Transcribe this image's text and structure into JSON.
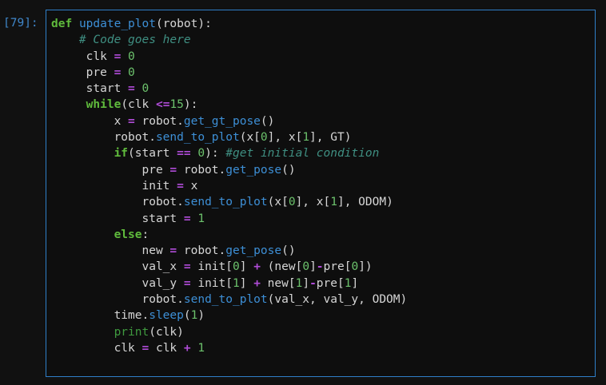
{
  "cell": {
    "prompt": "[79]:",
    "lines": [
      [
        [
          "kw",
          "def"
        ],
        [
          "tx",
          " "
        ],
        [
          "fn",
          "update_plot"
        ],
        [
          "tx",
          "(robot):"
        ]
      ],
      [
        [
          "tx",
          "    "
        ],
        [
          "cmt",
          "# Code goes here"
        ]
      ],
      [
        [
          "tx",
          "     clk "
        ],
        [
          "op",
          "="
        ],
        [
          "tx",
          " "
        ],
        [
          "num",
          "0"
        ]
      ],
      [
        [
          "tx",
          "     pre "
        ],
        [
          "op",
          "="
        ],
        [
          "tx",
          " "
        ],
        [
          "num",
          "0"
        ]
      ],
      [
        [
          "tx",
          "     start "
        ],
        [
          "op",
          "="
        ],
        [
          "tx",
          " "
        ],
        [
          "num",
          "0"
        ]
      ],
      [
        [
          "tx",
          "     "
        ],
        [
          "kw",
          "while"
        ],
        [
          "tx",
          "(clk "
        ],
        [
          "op",
          "<="
        ],
        [
          "num",
          "15"
        ],
        [
          "tx",
          "):"
        ]
      ],
      [
        [
          "tx",
          "         x "
        ],
        [
          "op",
          "="
        ],
        [
          "tx",
          " robot."
        ],
        [
          "fn",
          "get_gt_pose"
        ],
        [
          "tx",
          "()"
        ]
      ],
      [
        [
          "tx",
          "         robot."
        ],
        [
          "fn",
          "send_to_plot"
        ],
        [
          "tx",
          "(x["
        ],
        [
          "num",
          "0"
        ],
        [
          "tx",
          "], x["
        ],
        [
          "num",
          "1"
        ],
        [
          "tx",
          "], GT)"
        ]
      ],
      [
        [
          "tx",
          "         "
        ],
        [
          "kw",
          "if"
        ],
        [
          "tx",
          "(start "
        ],
        [
          "op",
          "=="
        ],
        [
          "tx",
          " "
        ],
        [
          "num",
          "0"
        ],
        [
          "tx",
          "): "
        ],
        [
          "cmt",
          "#get initial condition"
        ]
      ],
      [
        [
          "tx",
          "             pre "
        ],
        [
          "op",
          "="
        ],
        [
          "tx",
          " robot."
        ],
        [
          "fn",
          "get_pose"
        ],
        [
          "tx",
          "()"
        ]
      ],
      [
        [
          "tx",
          "             init "
        ],
        [
          "op",
          "="
        ],
        [
          "tx",
          " x"
        ]
      ],
      [
        [
          "tx",
          "             robot."
        ],
        [
          "fn",
          "send_to_plot"
        ],
        [
          "tx",
          "(x["
        ],
        [
          "num",
          "0"
        ],
        [
          "tx",
          "], x["
        ],
        [
          "num",
          "1"
        ],
        [
          "tx",
          "], ODOM)"
        ]
      ],
      [
        [
          "tx",
          "             start "
        ],
        [
          "op",
          "="
        ],
        [
          "tx",
          " "
        ],
        [
          "num",
          "1"
        ]
      ],
      [
        [
          "tx",
          "         "
        ],
        [
          "kw",
          "else"
        ],
        [
          "tx",
          ":"
        ]
      ],
      [
        [
          "tx",
          "             new "
        ],
        [
          "op",
          "="
        ],
        [
          "tx",
          " robot."
        ],
        [
          "fn",
          "get_pose"
        ],
        [
          "tx",
          "()"
        ]
      ],
      [
        [
          "tx",
          "             val_x "
        ],
        [
          "op",
          "="
        ],
        [
          "tx",
          " init["
        ],
        [
          "num",
          "0"
        ],
        [
          "tx",
          "] "
        ],
        [
          "op",
          "+"
        ],
        [
          "tx",
          " (new["
        ],
        [
          "num",
          "0"
        ],
        [
          "tx",
          "]"
        ],
        [
          "op",
          "-"
        ],
        [
          "tx",
          "pre["
        ],
        [
          "num",
          "0"
        ],
        [
          "tx",
          "])"
        ]
      ],
      [
        [
          "tx",
          "             val_y "
        ],
        [
          "op",
          "="
        ],
        [
          "tx",
          " init["
        ],
        [
          "num",
          "1"
        ],
        [
          "tx",
          "] "
        ],
        [
          "op",
          "+"
        ],
        [
          "tx",
          " new["
        ],
        [
          "num",
          "1"
        ],
        [
          "tx",
          "]"
        ],
        [
          "op",
          "-"
        ],
        [
          "tx",
          "pre["
        ],
        [
          "num",
          "1"
        ],
        [
          "tx",
          "]"
        ]
      ],
      [
        [
          "tx",
          "             robot."
        ],
        [
          "fn",
          "send_to_plot"
        ],
        [
          "tx",
          "(val_x, val_y, ODOM)"
        ]
      ],
      [
        [
          "tx",
          "         time."
        ],
        [
          "fn",
          "sleep"
        ],
        [
          "tx",
          "("
        ],
        [
          "num",
          "1"
        ],
        [
          "tx",
          ")"
        ]
      ],
      [
        [
          "tx",
          "         "
        ],
        [
          "bi",
          "print"
        ],
        [
          "tx",
          "(clk)"
        ]
      ],
      [
        [
          "tx",
          "         clk "
        ],
        [
          "op",
          "="
        ],
        [
          "tx",
          " clk "
        ],
        [
          "op",
          "+"
        ],
        [
          "tx",
          " "
        ],
        [
          "num",
          "1"
        ]
      ]
    ]
  },
  "colors": {
    "background": "#111111",
    "cell_border": "#2f7fc9",
    "keyword": "#5fba3c",
    "function": "#3d8fd6",
    "operator": "#b04cd8",
    "number": "#6cc26c",
    "comment": "#3f8f82",
    "builtin": "#3f9a3f",
    "text": "#d6d6d6"
  }
}
